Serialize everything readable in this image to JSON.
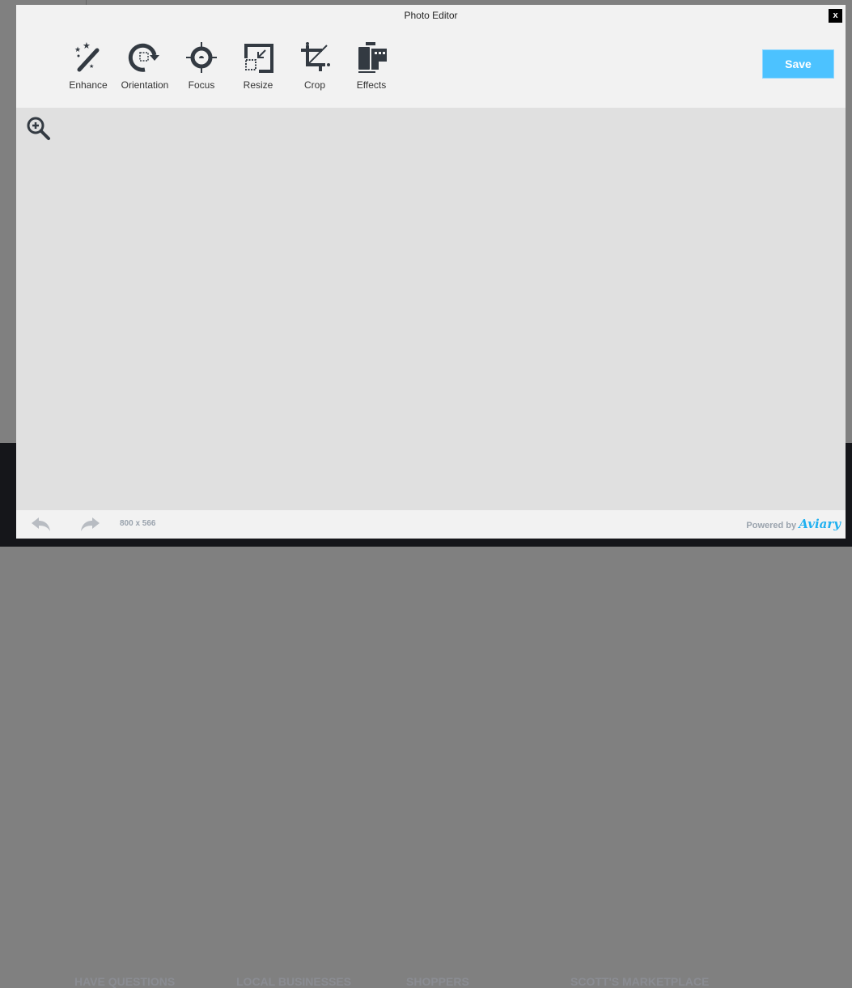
{
  "background_nav": [
    "HAVE QUESTIONS",
    "LOCAL BUSINESSES",
    "SHOPPERS",
    "SCOTT'S MARKETPLACE"
  ],
  "editor": {
    "title": "Photo Editor",
    "close_label": "x",
    "save_label": "Save",
    "tools": [
      {
        "label": "Enhance",
        "icon": "magic-wand-icon"
      },
      {
        "label": "Orientation",
        "icon": "rotate-icon"
      },
      {
        "label": "Focus",
        "icon": "crosshair-icon"
      },
      {
        "label": "Resize",
        "icon": "resize-icon"
      },
      {
        "label": "Crop",
        "icon": "crop-icon"
      },
      {
        "label": "Effects",
        "icon": "film-icon"
      }
    ],
    "dimensions": "800 x 566",
    "powered_by": "Powered by",
    "brand": "Aviary"
  },
  "colors": {
    "save": "#4cc2ff",
    "brand": "#1fb0f0"
  }
}
